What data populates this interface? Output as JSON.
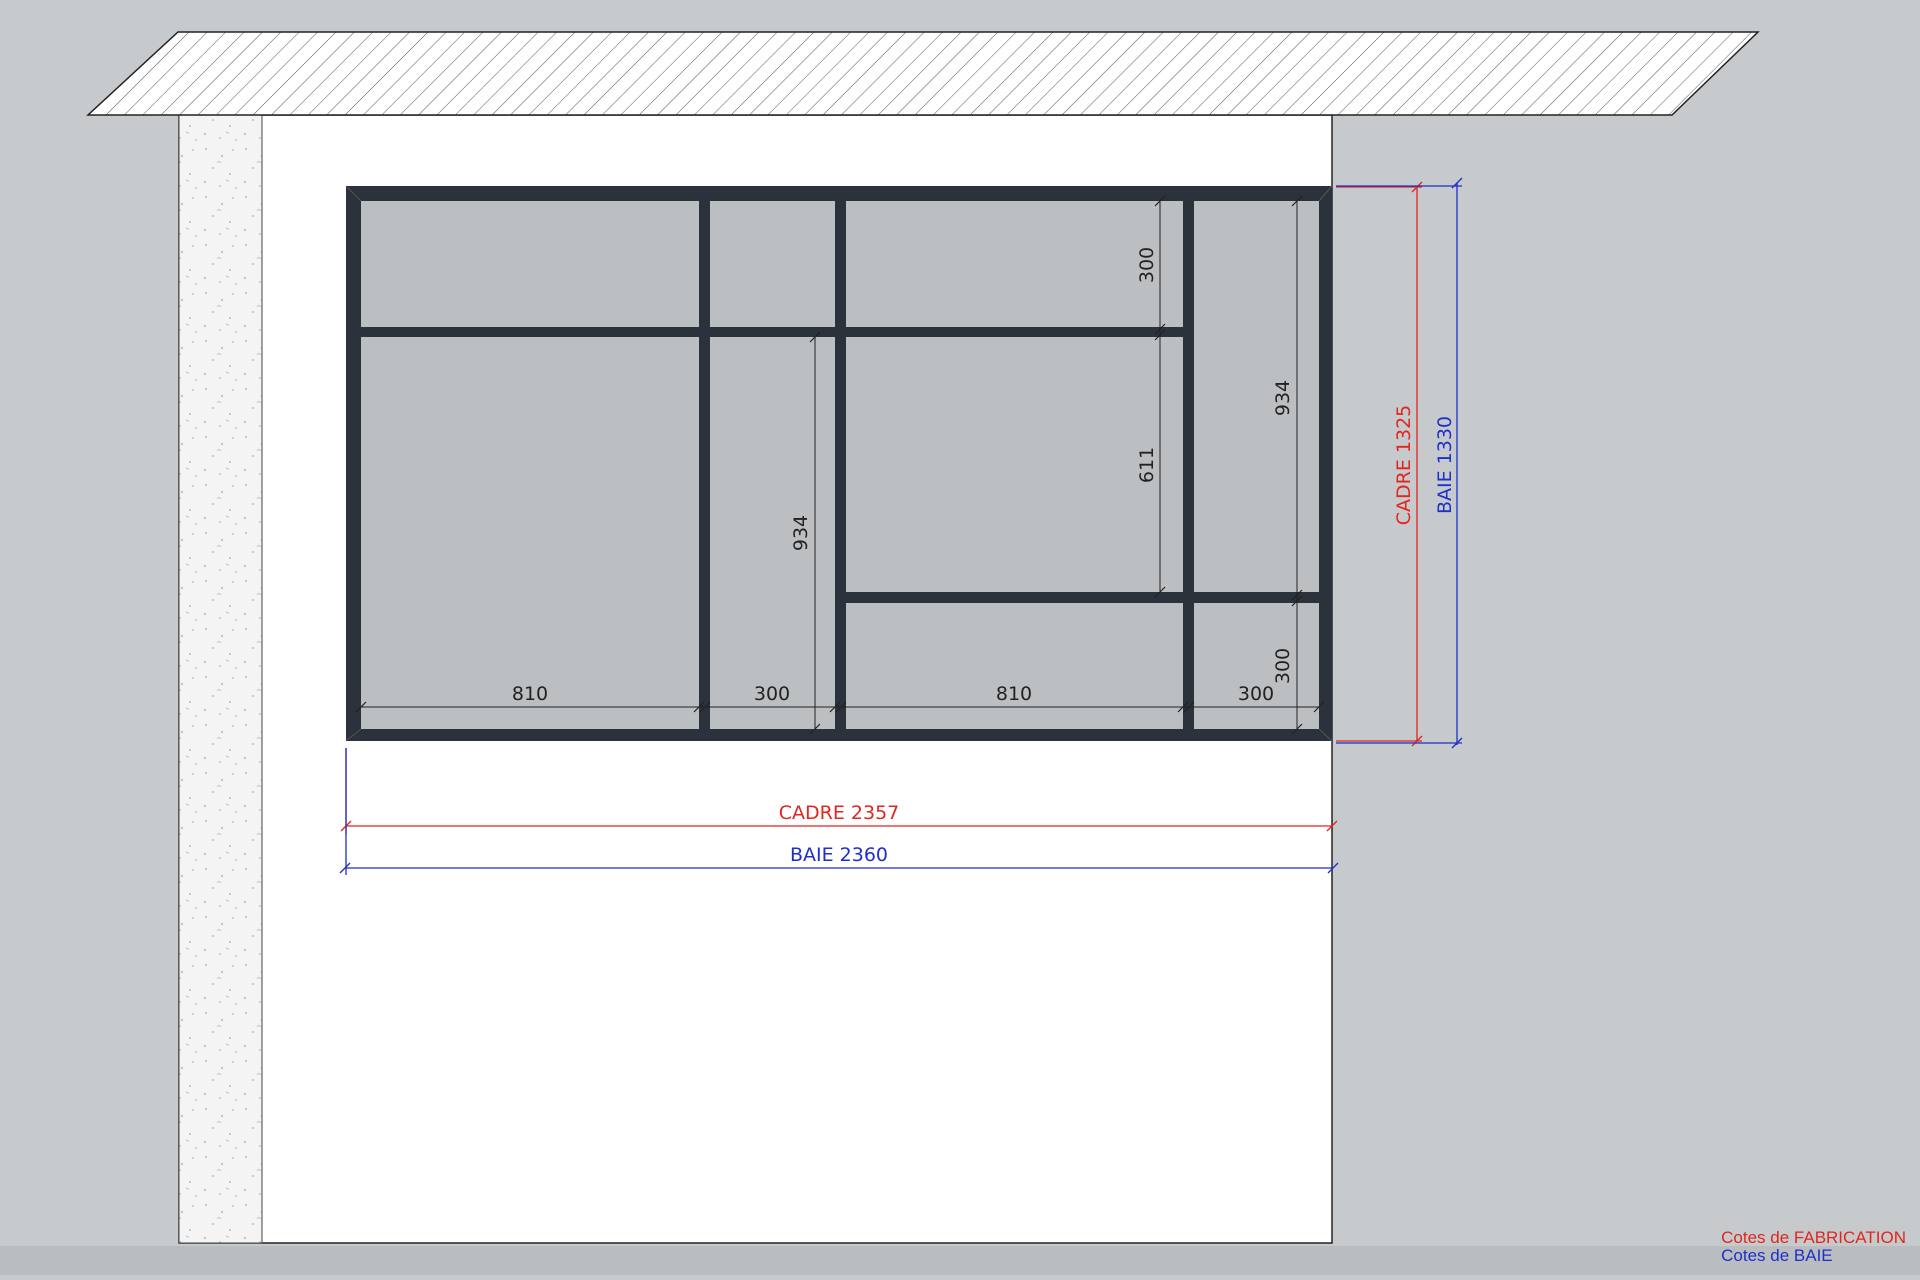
{
  "colors": {
    "background": "#c6cacc",
    "wall": "#ffffff",
    "frame": "#2b323b",
    "glass": "#bbbfc2",
    "fabrication": "#e0261f",
    "baie": "#1f2fc9"
  },
  "dimensions": {
    "w1": "810",
    "w2": "300",
    "w3": "810",
    "w4": "300",
    "h_top": "300",
    "h_mid": "611",
    "h_left": "934",
    "h_right": "934",
    "h_bottom": "300",
    "cadre_width": "CADRE 2357",
    "baie_width": "BAIE 2360",
    "cadre_height": "CADRE 1325",
    "baie_height": "BAIE 1330"
  },
  "legend": {
    "fabrication": "Cotes de FABRICATION",
    "baie": "Cotes de BAIE"
  }
}
